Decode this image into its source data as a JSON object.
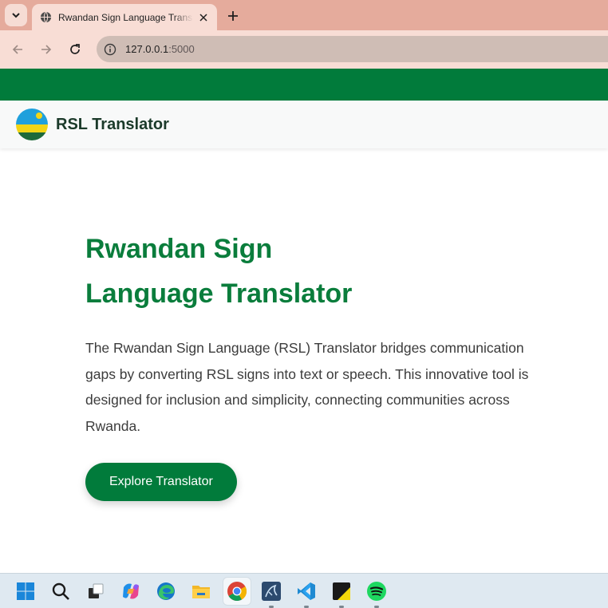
{
  "browser": {
    "tab_title": "Rwandan Sign Language Translator",
    "url_host": "127.0.0.1",
    "url_port": ":5000"
  },
  "site": {
    "brand": "RSL Translator"
  },
  "hero": {
    "title": "Rwandan Sign Language Translator",
    "description": "The Rwandan Sign Language (RSL) Translator bridges communication gaps by converting RSL signs into text or speech. This innovative tool is designed for inclusion and simplicity, connecting communities across Rwanda.",
    "cta_label": "Explore Translator"
  },
  "colors": {
    "brand_green": "#017b3b",
    "title_green": "#0a7d3c",
    "tab_strip": "#e5ab9c"
  },
  "taskbar": {
    "icons": [
      "windows-start-icon",
      "search-icon",
      "task-view-icon",
      "copilot-icon",
      "edge-icon",
      "file-explorer-icon",
      "chrome-icon",
      "mysql-workbench-icon",
      "vscode-icon",
      "sticky-notes-icon",
      "spotify-icon"
    ]
  }
}
